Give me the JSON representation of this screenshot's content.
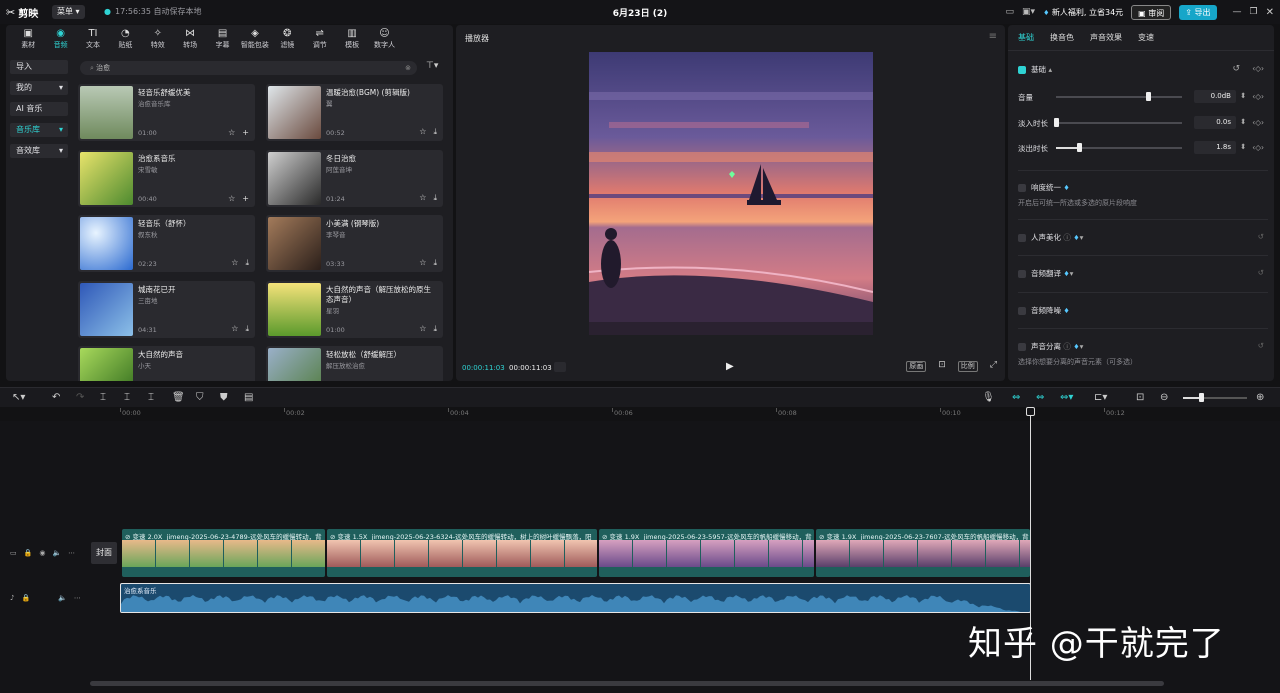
{
  "titlebar": {
    "logo_text": "剪映",
    "menu_label": "菜单",
    "save_status": "17:56:35 自动保存本地",
    "project_title": "6月23日 (2)",
    "promo": "新人福利, 立省34元",
    "review_label": "审阅",
    "export_label": "导出"
  },
  "categories": [
    {
      "icon": "media-icon",
      "glyph": "▣",
      "label": "素材"
    },
    {
      "icon": "audio-icon",
      "glyph": "◉",
      "label": "音频"
    },
    {
      "icon": "text-icon",
      "glyph": "TI",
      "label": "文本"
    },
    {
      "icon": "sticker-icon",
      "glyph": "◔",
      "label": "贴纸"
    },
    {
      "icon": "effects-icon",
      "glyph": "✧",
      "label": "特效"
    },
    {
      "icon": "transition-icon",
      "glyph": "⋈",
      "label": "转场"
    },
    {
      "icon": "caption-icon",
      "glyph": "▤",
      "label": "字幕"
    },
    {
      "icon": "smart-pack-icon",
      "glyph": "◈",
      "label": "智能包装"
    },
    {
      "icon": "filter-icon",
      "glyph": "❂",
      "label": "滤镜"
    },
    {
      "icon": "adjust-icon",
      "glyph": "⇌",
      "label": "调节"
    },
    {
      "icon": "template-icon",
      "glyph": "▥",
      "label": "模板"
    },
    {
      "icon": "digital-human-icon",
      "glyph": "☺",
      "label": "数字人"
    }
  ],
  "side_nav": {
    "import": "导入",
    "mine": "我的",
    "ai_music": "AI 音乐",
    "music_lib": "音乐库",
    "sfx_lib": "音效库"
  },
  "search": {
    "value": "治愈"
  },
  "music_cards": [
    {
      "name": "轻音乐舒缓优美",
      "artist": "治愈音乐库",
      "duration": "01:00"
    },
    {
      "name": "温暖治愈(BGM) (剪辑版)",
      "artist": "翼",
      "duration": "00:52"
    },
    {
      "name": "治愈系音乐",
      "artist": "宋雪敏",
      "duration": "00:40"
    },
    {
      "name": "冬日治愈",
      "artist": "阿莲音坤",
      "duration": "01:24"
    },
    {
      "name": "轻音乐（舒怀）",
      "artist": "叙东秋",
      "duration": "02:23"
    },
    {
      "name": "小美满 (钢琴版)",
      "artist": "李琴音",
      "duration": "03:33"
    },
    {
      "name": "城南花已开",
      "artist": "三亩地",
      "duration": "04:31"
    },
    {
      "name": "大自然的声音（解压放松的原生态声音）",
      "artist": "星羽",
      "duration": "01:00"
    },
    {
      "name": "大自然的声音",
      "artist": "小天",
      "duration": ""
    },
    {
      "name": "轻松放松（舒缓解压）",
      "artist": "解压放松治愈",
      "duration": ""
    }
  ],
  "player": {
    "title": "播放器",
    "current_time": "00:00:11:03",
    "total_time": "00:00:11:03",
    "ctrl_fit": "原画",
    "ctrl_ratio": "比例"
  },
  "right_panel": {
    "tabs": [
      "基础",
      "换音色",
      "声音效果",
      "变速"
    ],
    "section_basic": "基础",
    "volume_label": "音量",
    "volume_value": "0.0dB",
    "volume_level": 0.73,
    "fade_in_label": "淡入时长",
    "fade_in_value": "0.0s",
    "fade_in_level": 0.0,
    "fade_out_label": "淡出时长",
    "fade_out_value": "1.8s",
    "fade_out_level": 0.18,
    "loudness_label": "响度统一",
    "loudness_hint": "开启后可统一所选或多选的原片段响度",
    "voice_beauty_label": "人声美化",
    "audio_translate_label": "音频翻译",
    "noise_reduce_label": "音频降噪",
    "voice_sep_label": "声音分离",
    "voice_sep_hint": "选择你想要分离的声音元素（可多选）",
    "accent_color": "#2fd3d3"
  },
  "ruler_ticks": [
    "00:00",
    "00:02",
    "00:04",
    "00:06",
    "00:08",
    "00:10",
    "00:12"
  ],
  "timeline": {
    "cover_label": "封面",
    "clips": [
      {
        "speed": "变速 2.0X",
        "name": "jimeng-2025-06-23-4789-远处风车的缓慢转动，背"
      },
      {
        "speed": "变速 1.5X",
        "name": "jimeng-2025-06-23-6324-远处风车的缓慢转动，树上的树叶缓慢飘落，阳"
      },
      {
        "speed": "变速 1.9X",
        "name": "jimeng-2025-06-23-5957-远处风车的帆船缓慢移动，背"
      },
      {
        "speed": "变速 1.9X",
        "name": "jimeng-2025-06-23-7607-远处风车的帆船缓慢移动，背"
      }
    ],
    "audio_clip_name": "治愈系音乐"
  },
  "watermark": "知乎 @干就完了"
}
